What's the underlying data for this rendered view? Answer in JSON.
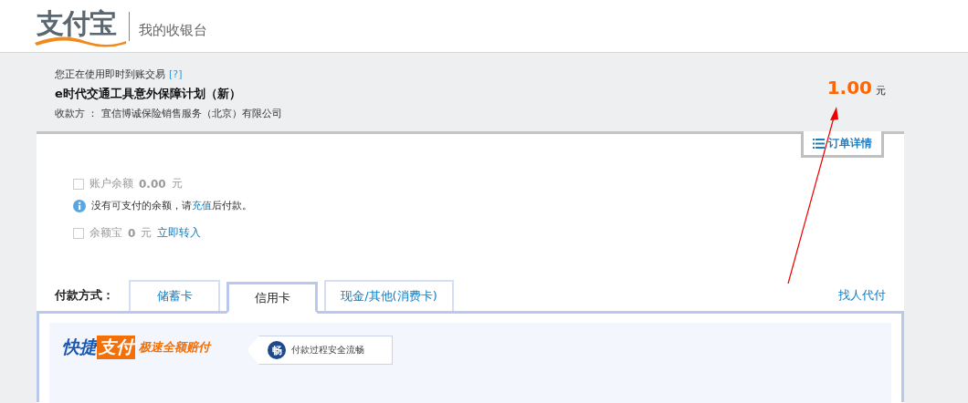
{
  "header": {
    "logo": "支付宝",
    "title": "我的收银台"
  },
  "order": {
    "notice": "您正在使用即时到账交易",
    "help_link": "[?]",
    "name": "e时代交通工具意外保障计划（新）",
    "payee": "收款方 ： 宜信博诚保险销售服务（北京）有限公司",
    "amount": "1.00",
    "currency": "元",
    "details_tab": "订单详情"
  },
  "balance": {
    "label": "账户余额",
    "amount": "0.00",
    "unit": "元",
    "checked": false,
    "disabled": true
  },
  "info": {
    "before": "没有可支付的余额，请",
    "link": "充值",
    "after": "后付款。"
  },
  "yuebao": {
    "label": "余额宝",
    "amount": "0",
    "unit": "元",
    "link": "立即转入",
    "checked": false,
    "disabled": true
  },
  "payment": {
    "label": "付款方式：",
    "tabs": [
      {
        "label": "储蓄卡",
        "selected": false
      },
      {
        "label": "信用卡",
        "selected": true
      },
      {
        "label": "现金/其他(消费卡)",
        "selected": false
      }
    ],
    "other_link": "找人代付"
  },
  "quickpay": {
    "brand_blue": "快捷",
    "brand_orange": "支付",
    "slogan": "极速全额赔付",
    "badge_icon": "畅",
    "badge_text": "付款过程安全流畅"
  }
}
